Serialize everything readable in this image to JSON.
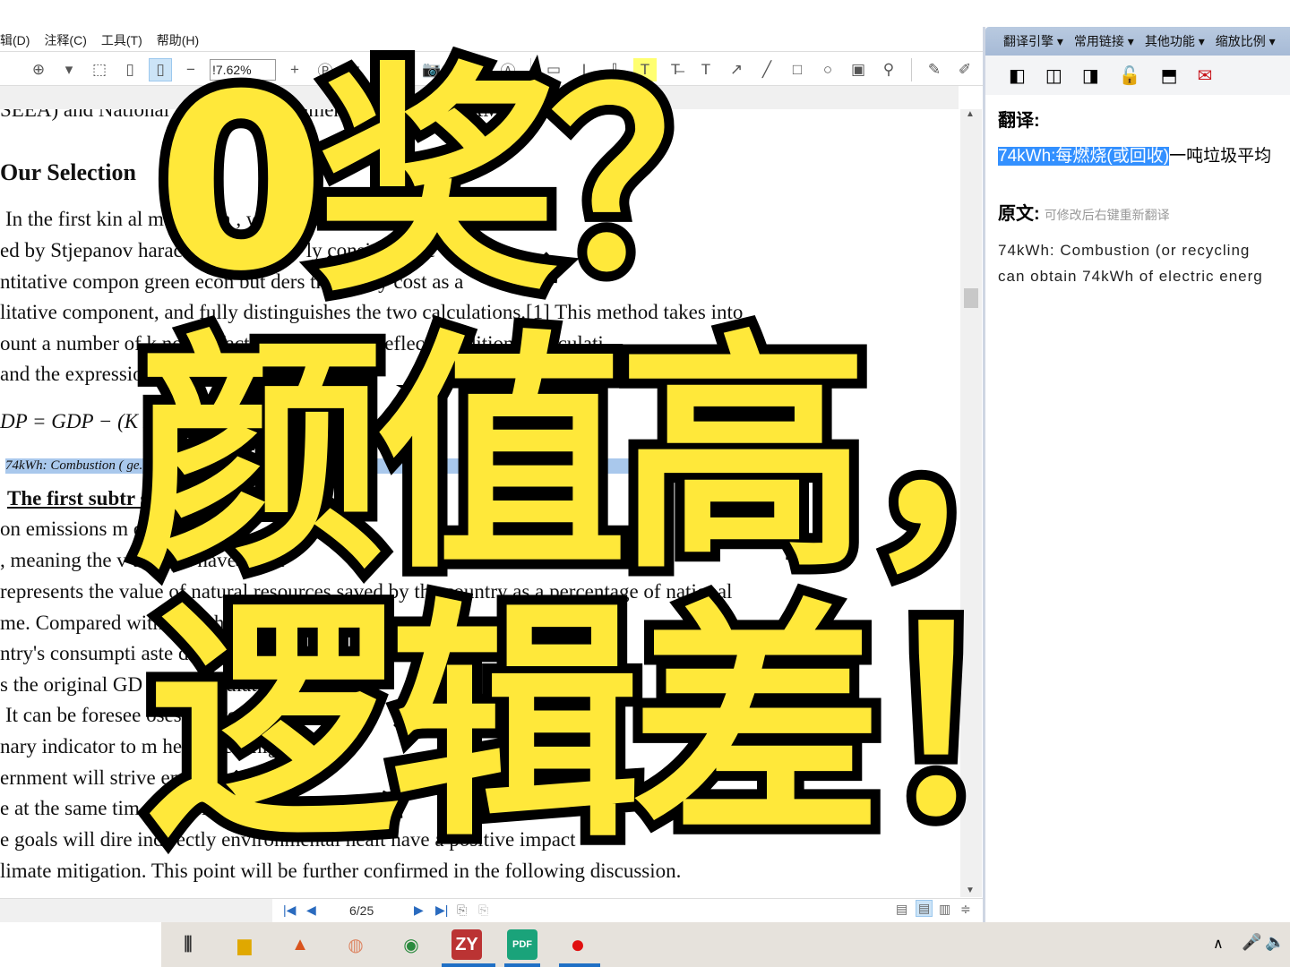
{
  "menu": [
    "辑(D)",
    "注释(C)",
    "工具(T)",
    "帮助(H)"
  ],
  "toolbar": {
    "zoom_value": "!7.62%"
  },
  "document": {
    "lines": [
      "SEEA) and National Accounting M                              nmental Accounts(NAMEA).",
      "Our Selection",
      "In the first kin     al       method m                  , we finally         a method pro-",
      "ed by Stjepanov          haract                    d is that it no      ly considers the",
      "ntitative compon          green econ        but         ders the       tunity cost as a",
      "litative component, and fully distinguishes the two calculations.[1] This method takes into",
      "ount a number of k      nomic factors that are not reflected i    ditional calculati",
      "and the expression     ll",
      "DP = GDP − (K        D         aste                              − (GNI / 100",
      "74kWh: Combustion (                                                             ge.",
      "The first subtr                   st of ca                  tion m",
      "on emissions m                      carbo                      nts",
      ", meaning the v       tricity t      have                 of          nd",
      "represents the value of natural resources saved by the country as a percentage of national",
      "me. Compared with o        o     ethods, t   equat        asure the sp      f",
      "ntry's consumpti                aste di                  extent, and i",
      "s the original GD                greates                  lculation di",
      "It can be foresee             oses G                     ove the met",
      "nary indicator to m             health,                  e a higher",
      "ernment will strive            emissio                    econom",
      "e at the same tim                   ou                   olici",
      "e goals will dire        indirectly     environmental healt     have a positive impact",
      "limate mitigation. This point will be further confirmed in the following discussion."
    ]
  },
  "status": {
    "page": "6/25"
  },
  "right_panel": {
    "menu": [
      "翻译引擎 ▾",
      "常用链接 ▾",
      "其他功能 ▾",
      "缩放比例 ▾"
    ],
    "translation_label": "翻译:",
    "translation_selected": "74kWh:每燃烧(或回收)",
    "translation_rest": "一吨垃圾平均",
    "original_label": "原文:",
    "original_hint": "可修改后右键重新翻译",
    "original_lines": [
      "74kWh: Combustion (or recycling",
      "can obtain 74kWh of electric energ"
    ]
  },
  "overlay": {
    "line1": "0奖？",
    "line2": "颜值高，",
    "line3": "逻辑差！"
  },
  "colors": {
    "overlay_fill": "#ffe83a",
    "selection": "#3390ff",
    "mail": "#c8161d"
  }
}
